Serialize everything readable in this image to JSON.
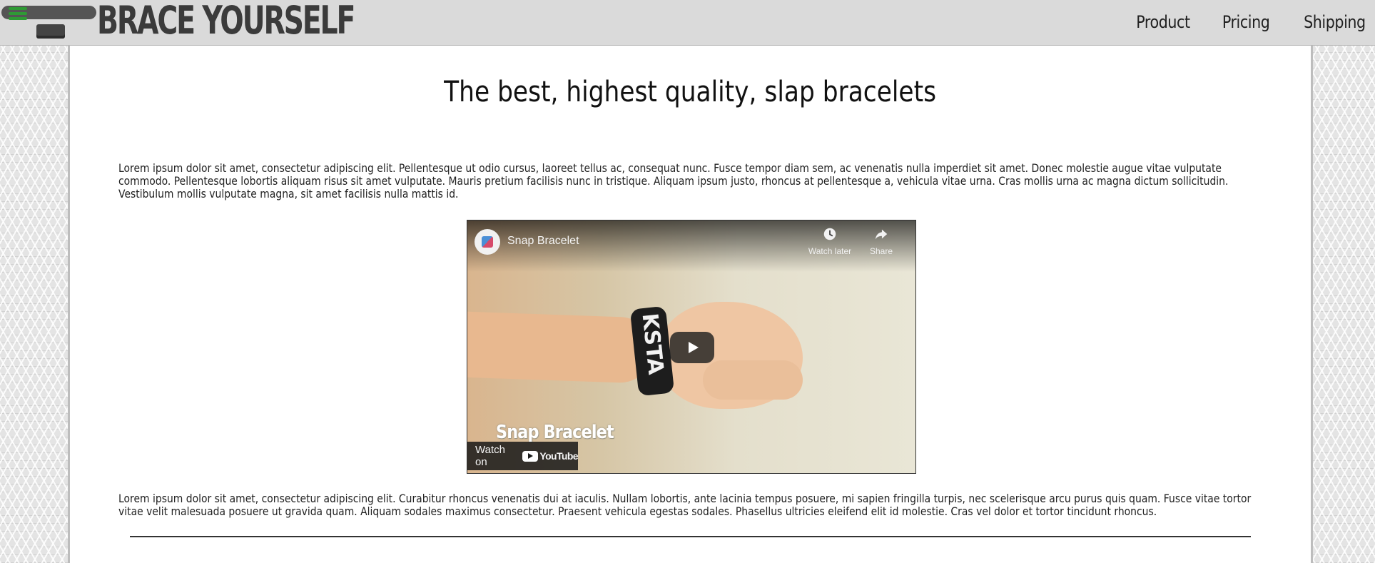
{
  "header": {
    "brand": "BRACE YOURSELF",
    "menu_icon": "hamburger-menu-icon",
    "nav": [
      {
        "label": "Product"
      },
      {
        "label": "Pricing"
      },
      {
        "label": "Shipping"
      }
    ]
  },
  "main": {
    "headline": "The best, highest quality, slap bracelets",
    "paragraph_1": "Lorem ipsum dolor sit amet, consectetur adipiscing elit. Pellentesque ut odio cursus, laoreet tellus ac, consequat nunc. Fusce tempor diam sem, ac venenatis nulla imperdiet sit amet. Donec molestie augue vitae vulputate commodo. Pellentesque lobortis aliquam risus sit amet vulputate. Mauris pretium facilisis nunc in tristique. Aliquam ipsum justo, rhoncus at pellentesque a, vehicula vitae urna. Cras mollis urna ac magna dictum sollicitudin. Vestibulum mollis vulputate magna, sit amet facilisis nulla mattis id.",
    "paragraph_2": "Lorem ipsum dolor sit amet, consectetur adipiscing elit. Curabitur rhoncus venenatis dui at iaculis. Nullam lobortis, ante lacinia tempus posuere, mi sapien fringilla turpis, nec scelerisque arcu purus quis quam. Fusce vitae tortor vitae velit malesuada posuere ut gravida quam. Aliquam sodales maximus consectetur. Praesent vehicula egestas sodales. Phasellus ultricies eleifend elit id molestie. Cras vel dolor et tortor tincidunt rhoncus."
  },
  "video": {
    "title": "Snap Bracelet",
    "watch_later_label": "Watch later",
    "share_label": "Share",
    "overlay_text": "Snap Bracelet",
    "band_text": "KSTA",
    "watch_on_label": "Watch on",
    "youtube_wordmark": "YouTube",
    "play_icon": "play-icon"
  },
  "colors": {
    "header_bg": "#dadada",
    "brand_text": "#3b3b3b",
    "menu_icon": "#2f9a35",
    "panel_bg": "#ffffff"
  }
}
